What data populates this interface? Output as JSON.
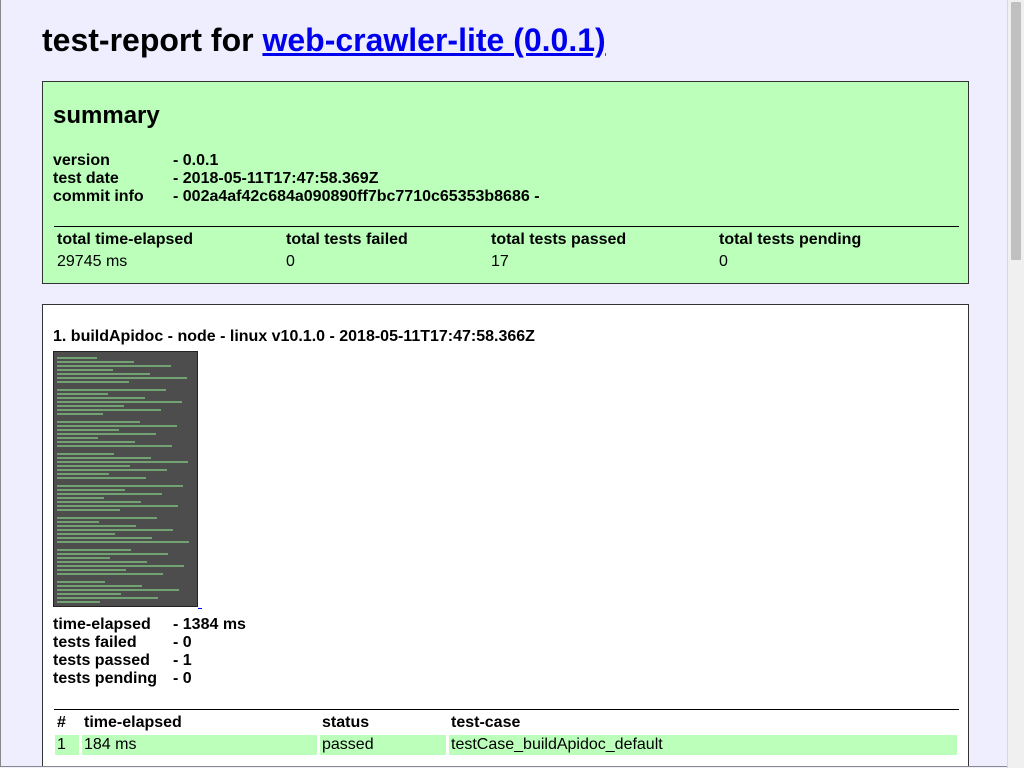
{
  "header": {
    "title_prefix": "test-report for ",
    "title_link": "web-crawler-lite (0.0.1)"
  },
  "summary": {
    "heading": "summary",
    "info": [
      {
        "key": "version",
        "value": "- 0.0.1"
      },
      {
        "key": "test date",
        "value": "- 2018-05-11T17:47:58.369Z"
      },
      {
        "key": "commit info",
        "value": "- 002a4af42c684a090890ff7bc7710c65353b8686 -"
      }
    ],
    "columns": [
      "total time-elapsed",
      "total tests failed",
      "total tests passed",
      "total tests pending"
    ],
    "values": [
      "29745 ms",
      "0",
      "17",
      "0"
    ]
  },
  "test": {
    "heading": "1. buildApidoc - node - linux v10.1.0 - 2018-05-11T17:47:58.366Z",
    "stats": [
      {
        "key": "time-elapsed",
        "value": "- 1384 ms"
      },
      {
        "key": "tests failed",
        "value": "- 0"
      },
      {
        "key": "tests passed",
        "value": "- 1"
      },
      {
        "key": "tests pending",
        "value": "- 0"
      }
    ],
    "case_columns": [
      "#",
      "time-elapsed",
      "status",
      "test-case"
    ],
    "cases": [
      {
        "num": "1",
        "time": "184 ms",
        "status": "passed",
        "name": "testCase_buildApidoc_default"
      }
    ]
  },
  "colors": {
    "page_bg": "#eeeeff",
    "summary_bg": "#bbffbb",
    "passed_row_bg": "#bbffbb",
    "link": "#0000ee",
    "screenshot_bg": "#4d4d4d"
  },
  "icons": {
    "screenshot": "terminal-screenshot-thumbnail"
  }
}
